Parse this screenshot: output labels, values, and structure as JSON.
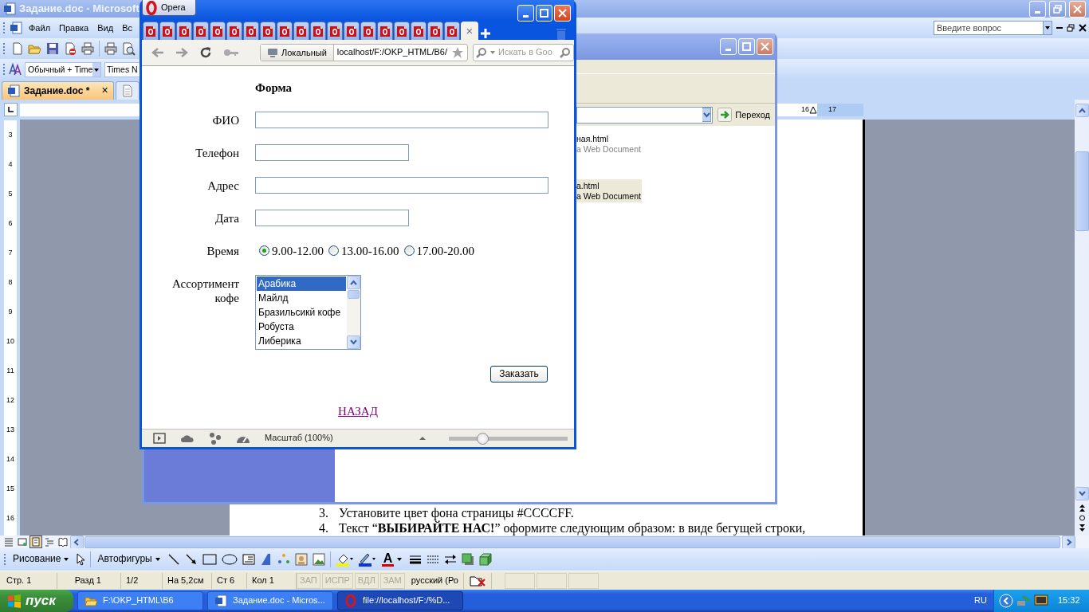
{
  "word": {
    "title": "Задание.doc - Microsoft",
    "menu": [
      "Файл",
      "Правка",
      "Вид",
      "Вс"
    ],
    "question_box": {
      "placeholder": "Введите вопрос"
    },
    "style_box": "Обычный + Time",
    "font_box": "Times N",
    "doc_tabs": [
      {
        "label": "Задание.doc",
        "mark": "*",
        "close": "×",
        "selected": true
      },
      {
        "selected": false
      }
    ],
    "ruler_labels": [
      "16",
      "17"
    ],
    "vertical_ruler": [
      "3",
      "4",
      "5",
      "6",
      "7",
      "8",
      "9",
      "10",
      "11",
      "12",
      "13",
      "14",
      "15",
      "16"
    ],
    "page_lines": [
      {
        "number": "3.",
        "text": "Установите цвет фона страницы #CCCCFF."
      },
      {
        "number": "4.",
        "text": "Текст “**ВЫБИРАЙТЕ НАС!**” оформите следующим образом: в виде бегущей  строки,"
      }
    ],
    "view_buttons": [
      {
        "selected": false
      },
      {
        "selected": false
      },
      {
        "selected": true
      },
      {
        "selected": false
      },
      {
        "selected": false
      }
    ],
    "drawing_toolbar": {
      "draw_menu": "Рисование",
      "autoshapes": "Автофигуры",
      "font_color_glyph": "A"
    },
    "status_bar": [
      {
        "text": "Стр. 1",
        "disabled": false
      },
      {
        "text": "Разд 1",
        "disabled": false
      },
      {
        "text": "1/2",
        "disabled": false
      },
      {
        "text": "На 5,2см",
        "disabled": false
      },
      {
        "text": "Ст 6",
        "disabled": false
      },
      {
        "text": "Кол 1",
        "disabled": false
      },
      {
        "text": "ЗАП",
        "disabled": true
      },
      {
        "text": "ИСПР",
        "disabled": true
      },
      {
        "text": "ВДЛ",
        "disabled": true
      },
      {
        "text": "ЗАМ",
        "disabled": true
      },
      {
        "text": "русский (Ро",
        "disabled": false
      }
    ]
  },
  "explorer": {
    "go_button": "Переход",
    "files": [
      {
        "name": "ная.html",
        "type": "a Web Document",
        "selected": false
      },
      {
        "name": "a.html",
        "type": "a Web Document",
        "selected": true
      }
    ]
  },
  "opera": {
    "menu_button": "Opera",
    "tabs": [
      {
        "selected": false
      },
      {
        "selected": false
      },
      {
        "selected": false
      },
      {
        "selected": false
      },
      {
        "selected": false
      },
      {
        "selected": false
      },
      {
        "selected": false
      },
      {
        "selected": false
      },
      {
        "selected": false
      },
      {
        "selected": false
      },
      {
        "selected": false
      },
      {
        "selected": false
      },
      {
        "selected": false
      },
      {
        "selected": false
      },
      {
        "selected": false
      },
      {
        "selected": false
      },
      {
        "selected": false
      },
      {
        "selected": false
      },
      {
        "selected": false
      },
      {
        "selected": true,
        "close": "×"
      }
    ],
    "site_badge": "Локальный",
    "url": "localhost/F:/OKP_HTML/B6/",
    "search": {
      "placeholder": "Искать в Goo"
    },
    "form": {
      "title": "Форма",
      "rows": [
        {
          "kind": "wide",
          "label": "ФИО"
        },
        {
          "kind": "narrow",
          "label": "Телефон"
        },
        {
          "kind": "wide",
          "label": "Адрес"
        },
        {
          "kind": "narrow",
          "label": "Дата"
        },
        {
          "kind": "radio",
          "label": "Время",
          "options": [
            {
              "label": "9.00-12.00",
              "selected": true
            },
            {
              "label": "13.00-16.00",
              "selected": false
            },
            {
              "label": "17.00-20.00",
              "selected": false
            }
          ]
        },
        {
          "kind": "list",
          "label": "Ассортимент кофе",
          "options": [
            {
              "label": "Арабика",
              "selected": true
            },
            {
              "label": "Майлд",
              "selected": false
            },
            {
              "label": "Бразильсикй кофе",
              "selected": false
            },
            {
              "label": "Робуста",
              "selected": false
            },
            {
              "label": "Либерика",
              "selected": false
            }
          ]
        }
      ],
      "submit": "Заказать",
      "back_link": "НАЗАД"
    },
    "zoom_label": "Масштаб (100%)",
    "zoom": {
      "level": 0.28
    }
  },
  "taskbar": {
    "start": "пуск",
    "tasks": [
      {
        "kind": "folder",
        "label": "F:\\OKP_HTML\\B6",
        "selected": false
      },
      {
        "kind": "word",
        "label": "Задание.doc - Micros...",
        "selected": false
      },
      {
        "kind": "opera",
        "label": "file://localhost/F:/%D...",
        "selected": true
      }
    ],
    "language": "RU",
    "clock": "15:32"
  }
}
